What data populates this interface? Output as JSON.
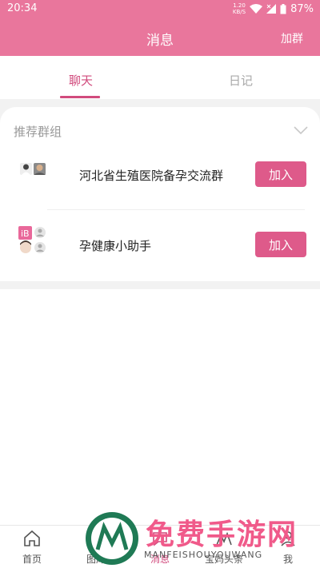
{
  "status_bar": {
    "time": "20:34",
    "net_speed_value": "1.20",
    "net_speed_unit": "KB/S",
    "battery": "87%"
  },
  "header": {
    "title": "消息",
    "join_group": "加群"
  },
  "tabs": [
    {
      "label": "聊天",
      "active": true
    },
    {
      "label": "日记",
      "active": false
    }
  ],
  "recommend": {
    "title": "推荐群组",
    "groups": [
      {
        "name": "河北省生殖医院备孕交流群",
        "button": "加入"
      },
      {
        "name": "孕健康小助手",
        "button": "加入"
      }
    ]
  },
  "tabbar": {
    "items": [
      {
        "label": "首页",
        "icon": "home-icon"
      },
      {
        "label": "图库",
        "icon": "gallery-icon"
      },
      {
        "label": "消息",
        "icon": "message-icon"
      },
      {
        "label": "宝妈头条",
        "icon": "headline-icon"
      },
      {
        "label": "我",
        "icon": "profile-icon"
      }
    ]
  },
  "watermark": {
    "text": "免费手游网",
    "subtext": "MANFEISHOUYOUWANG"
  },
  "colors": {
    "brand": "#e9769c",
    "accent": "#d14b7d",
    "button": "#de5a8a"
  }
}
